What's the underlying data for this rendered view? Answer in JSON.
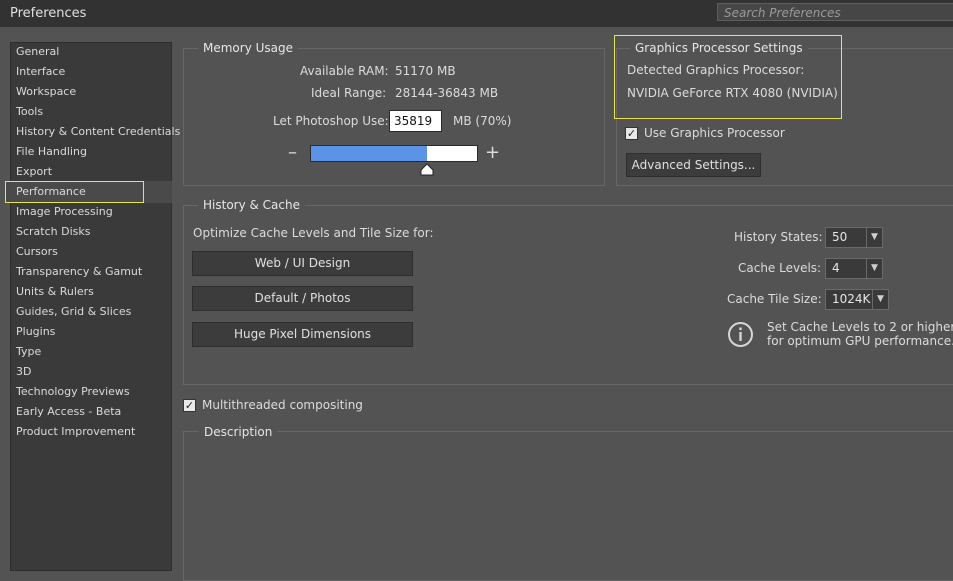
{
  "window": {
    "title": "Preferences"
  },
  "search": {
    "placeholder": "Search Preferences"
  },
  "sidebar": {
    "items": [
      {
        "label": "General"
      },
      {
        "label": "Interface"
      },
      {
        "label": "Workspace"
      },
      {
        "label": "Tools"
      },
      {
        "label": "History & Content Credentials"
      },
      {
        "label": "File Handling"
      },
      {
        "label": "Export"
      },
      {
        "label": "Performance"
      },
      {
        "label": "Image Processing"
      },
      {
        "label": "Scratch Disks"
      },
      {
        "label": "Cursors"
      },
      {
        "label": "Transparency & Gamut"
      },
      {
        "label": "Units & Rulers"
      },
      {
        "label": "Guides, Grid & Slices"
      },
      {
        "label": "Plugins"
      },
      {
        "label": "Type"
      },
      {
        "label": "3D"
      },
      {
        "label": "Technology Previews"
      },
      {
        "label": "Early Access - Beta"
      },
      {
        "label": "Product Improvement"
      }
    ],
    "selected": "Performance"
  },
  "memory": {
    "title": "Memory Usage",
    "available_label": "Available RAM:",
    "available_value": "51170 MB",
    "ideal_label": "Ideal Range:",
    "ideal_value": "28144-36843 MB",
    "let_label": "Let Photoshop Use:",
    "let_value": "35819",
    "let_unit": "MB (70%)",
    "minus": "–",
    "plus": "+",
    "slider_fraction": 0.7,
    "slider_color": "#5b94e6"
  },
  "gpu": {
    "title": "Graphics Processor Settings",
    "detected_label": "Detected Graphics Processor:",
    "detected_value": "NVIDIA GeForce RTX 4080 (NVIDIA)",
    "use_label": "Use Graphics Processor",
    "use_checked": true,
    "advanced_button": "Advanced Settings..."
  },
  "history_cache": {
    "title": "History & Cache",
    "optimize_label": "Optimize Cache Levels and Tile Size for:",
    "buttons": [
      "Web / UI Design",
      "Default / Photos",
      "Huge Pixel Dimensions"
    ],
    "history_states_label": "History States:",
    "history_states_value": "50",
    "cache_levels_label": "Cache Levels:",
    "cache_levels_value": "4",
    "cache_tile_label": "Cache Tile Size:",
    "cache_tile_value": "1024K",
    "info_line1": "Set Cache Levels to 2 or higher",
    "info_line2": "for optimum GPU performance."
  },
  "multithreaded": {
    "label": "Multithreaded compositing",
    "checked": true
  },
  "description": {
    "title": "Description"
  },
  "colors": {
    "background": "#535353",
    "titlebar": "#323232",
    "highlight": "#e6e64c"
  }
}
